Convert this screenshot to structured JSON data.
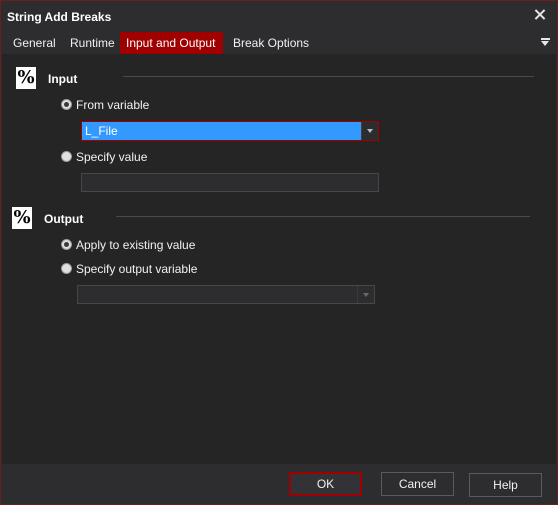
{
  "window": {
    "title": "String Add Breaks"
  },
  "tabs": [
    {
      "label": "General",
      "active": false
    },
    {
      "label": "Runtime",
      "active": false
    },
    {
      "label": "Input and Output",
      "active": true
    },
    {
      "label": "Break Options",
      "active": false
    }
  ],
  "input_section": {
    "label": "Input",
    "icon": "%",
    "from_variable_label": "From variable",
    "from_variable_value": "L_File",
    "specify_value_label": "Specify value",
    "specify_value_text": ""
  },
  "output_section": {
    "label": "Output",
    "icon": "%",
    "apply_existing_label": "Apply to existing value",
    "specify_output_label": "Specify output variable",
    "output_variable_value": ""
  },
  "buttons": {
    "ok": "OK",
    "cancel": "Cancel",
    "help": "Help"
  },
  "colors": {
    "accent": "#a00000",
    "selection": "#3399ff",
    "background": "#2d2d30"
  }
}
